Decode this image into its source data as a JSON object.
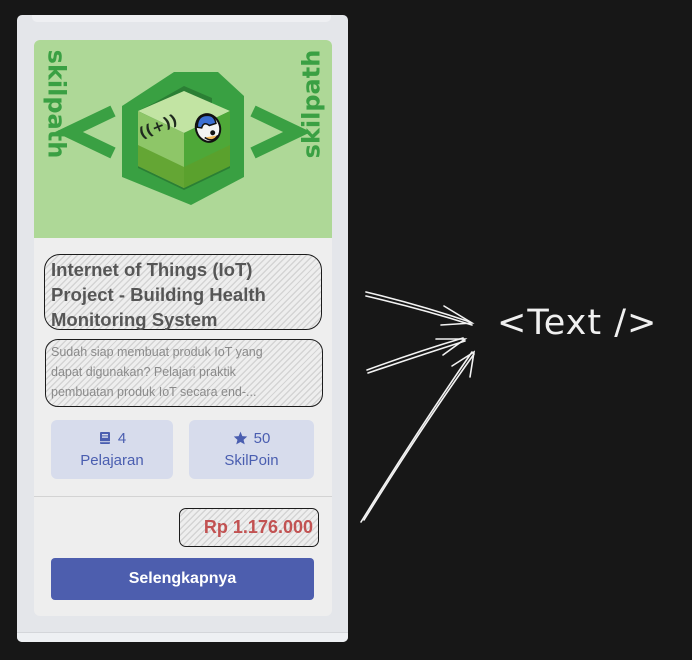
{
  "course": {
    "brand_left": "skilpath",
    "brand_right": "skilpath",
    "title": "Internet of Things (IoT) Project - Building Health Monitoring System",
    "description_lines": [
      "Sudah siap membuat produk IoT yang",
      "dapat digunakan? Pelajari praktik",
      "pembuatan produk IoT secara end-..."
    ],
    "lessons": {
      "count": "4",
      "label": "Pelajaran",
      "icon": "book-icon"
    },
    "points": {
      "count": "50",
      "label": "SkilPoin",
      "icon": "star-icon"
    },
    "price": "Rp 1.176.000",
    "detail_button": "Selengkapnya"
  },
  "annotation": {
    "label": "<Text />"
  },
  "colors": {
    "accent": "#4d5eae",
    "price": "#c25252",
    "hero_bg": "#aed897",
    "brand": "#3aa043"
  }
}
